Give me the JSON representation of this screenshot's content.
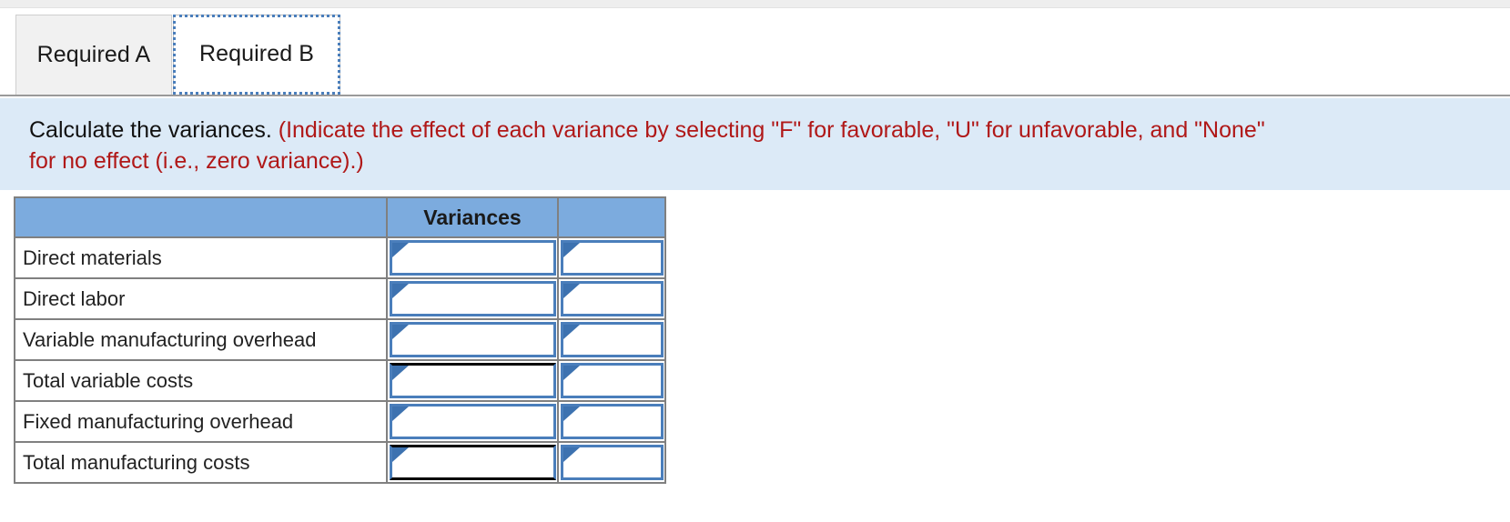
{
  "tabs": [
    {
      "label": "Required A",
      "active": false
    },
    {
      "label": "Required B",
      "active": true
    }
  ],
  "banner": {
    "lead": "Calculate the variances.",
    "note_line1": " (Indicate the effect of each variance by selecting \"F\" for favorable, \"U\" for unfavorable, and \"None\"",
    "note_line2": "for no effect (i.e., zero variance).)"
  },
  "table": {
    "headers": [
      "",
      "Variances",
      ""
    ],
    "rows": [
      {
        "label": "Direct materials",
        "variance": "",
        "effect": "",
        "rule_top": false,
        "rule_bottom": false
      },
      {
        "label": "Direct labor",
        "variance": "",
        "effect": "",
        "rule_top": false,
        "rule_bottom": false
      },
      {
        "label": "Variable manufacturing overhead",
        "variance": "",
        "effect": "",
        "rule_top": false,
        "rule_bottom": false
      },
      {
        "label": "Total variable costs",
        "variance": "",
        "effect": "",
        "rule_top": true,
        "rule_bottom": false
      },
      {
        "label": "Fixed manufacturing overhead",
        "variance": "",
        "effect": "",
        "rule_top": false,
        "rule_bottom": false
      },
      {
        "label": "Total manufacturing costs",
        "variance": "",
        "effect": "",
        "rule_top": true,
        "rule_bottom": true
      }
    ]
  },
  "colors": {
    "header_blue": "#7cabde",
    "banner_blue": "#dceaf7",
    "input_border_blue": "#4a7ebb",
    "note_red": "#b01818",
    "grid_gray": "#808080"
  }
}
